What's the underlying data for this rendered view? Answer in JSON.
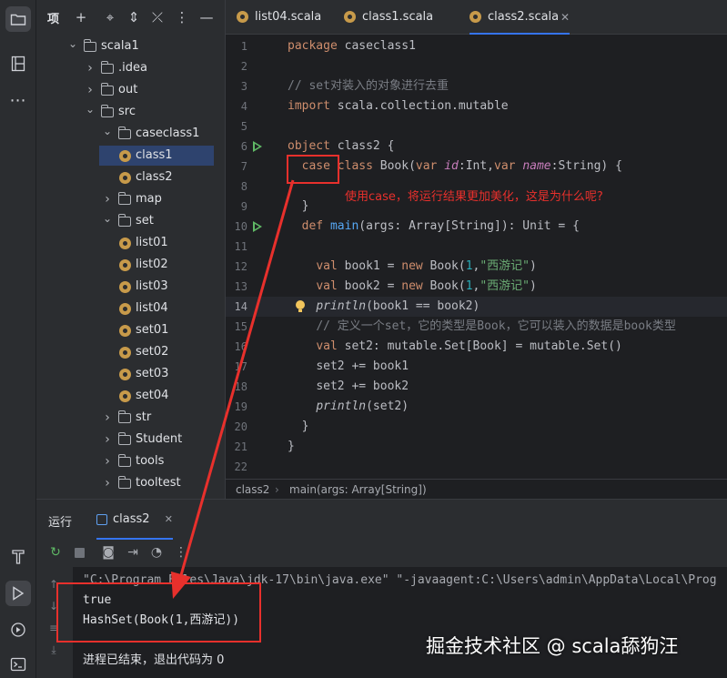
{
  "project_panel": {
    "title": "项",
    "tree": [
      {
        "label": "scala1",
        "kind": "folder",
        "depth": 0,
        "open": true
      },
      {
        "label": ".idea",
        "kind": "folder",
        "depth": 1,
        "open": false
      },
      {
        "label": "out",
        "kind": "folder",
        "depth": 1,
        "open": false
      },
      {
        "label": "src",
        "kind": "folder",
        "depth": 1,
        "open": true
      },
      {
        "label": "caseclass1",
        "kind": "folder",
        "depth": 2,
        "open": true
      },
      {
        "label": "class1",
        "kind": "object",
        "depth": 3,
        "selected": true
      },
      {
        "label": "class2",
        "kind": "object",
        "depth": 3
      },
      {
        "label": "map",
        "kind": "folder",
        "depth": 2,
        "open": false
      },
      {
        "label": "set",
        "kind": "folder",
        "depth": 2,
        "open": true
      },
      {
        "label": "list01",
        "kind": "object",
        "depth": 3
      },
      {
        "label": "list02",
        "kind": "object",
        "depth": 3
      },
      {
        "label": "list03",
        "kind": "object",
        "depth": 3
      },
      {
        "label": "list04",
        "kind": "object",
        "depth": 3
      },
      {
        "label": "set01",
        "kind": "object",
        "depth": 3
      },
      {
        "label": "set02",
        "kind": "object",
        "depth": 3
      },
      {
        "label": "set03",
        "kind": "object",
        "depth": 3
      },
      {
        "label": "set04",
        "kind": "object",
        "depth": 3
      },
      {
        "label": "str",
        "kind": "folder",
        "depth": 2,
        "open": false
      },
      {
        "label": "Student",
        "kind": "folder",
        "depth": 2,
        "open": false
      },
      {
        "label": "tools",
        "kind": "folder",
        "depth": 2,
        "open": false
      },
      {
        "label": "tooltest",
        "kind": "folder",
        "depth": 2,
        "open": false
      }
    ]
  },
  "editor": {
    "tabs": [
      {
        "label": "list04.scala",
        "active": false
      },
      {
        "label": "class1.scala",
        "active": false
      },
      {
        "label": "class2.scala",
        "active": true
      }
    ],
    "tab_close": "✕",
    "current_line": 14,
    "line_numbers": [
      "1",
      "2",
      "3",
      "4",
      "5",
      "6",
      "7",
      "8",
      "9",
      "10",
      "11",
      "12",
      "13",
      "14",
      "15",
      "16",
      "17",
      "18",
      "19",
      "20",
      "21",
      "22"
    ],
    "run_gutter_lines": [
      6,
      10
    ],
    "code": {
      "l1_kw": "package",
      "l1_rest": " caseclass1",
      "l3": "// set对装入的对象进行去重",
      "l4_kw": "import",
      "l4_rest": " scala.collection.mutable",
      "l6_kw": "object",
      "l6_rest": " class2 {",
      "l7_case": "case",
      "l7_kw_class": " class",
      " l7_name": "",
      "l7_book": " Book(",
      "l7_var1": "var",
      "l7_id": " id",
      "l7_int": ":Int,",
      "l7_var2": "var",
      "l7_nm": " name",
      "l7_str": ":String) {",
      "l9": "}",
      "l10_kw": "def",
      "l10_fn": " main",
      "l10_rest": "(args: Array[String]): Unit = {",
      "l12_kw": "val",
      "l12_a": " book1 = ",
      "l12_new": "new",
      "l12_b": " Book(",
      "l12_num": "1",
      "l12_c": ",",
      "l12_str": "\"西游记\"",
      "l12_d": ")",
      "l13_kw": "val",
      "l13_a": " book2 = ",
      "l13_new": "new",
      "l13_b": " Book(",
      "l13_num": "1",
      "l13_c": ",",
      "l13_str": "\"西游记\"",
      "l13_d": ")",
      "l14_fn": "println",
      "l14_rest": "(book1 == book2)",
      "l15": "// 定义一个set，它的类型是Book，它可以装入的数据是book类型",
      "l16_kw": "val",
      "l16_rest": " set2: mutable.Set[Book] = mutable.Set()",
      "l17": "set2 += book1",
      "l18": "set2 += book2",
      "l19_fn": "println",
      "l19_rest": "(set2)",
      "l20": "}",
      "l21": "}"
    },
    "breadcrumb": [
      "class2",
      "main(args: Array[String])"
    ],
    "annotation": "使用case，将运行结果更加美化，这是为什么呢?"
  },
  "run_panel": {
    "title": "运行",
    "tab_label": "class2",
    "tab_close": "✕",
    "console": [
      "\"C:\\Program Files\\Java\\jdk-17\\bin\\java.exe\" \"-javaagent:C:\\Users\\admin\\AppData\\Local\\Prog",
      "true",
      "HashSet(Book(1,西游记))",
      "",
      "进程已结束，退出代码为 0"
    ]
  },
  "watermark": "掘金技术社区 @ scala舔狗汪",
  "colors": {
    "accent": "#3574f0",
    "annotation_red": "#e8302c",
    "keyword": "#cf8e6d",
    "string": "#6aab73",
    "run_green": "#5fb865"
  }
}
